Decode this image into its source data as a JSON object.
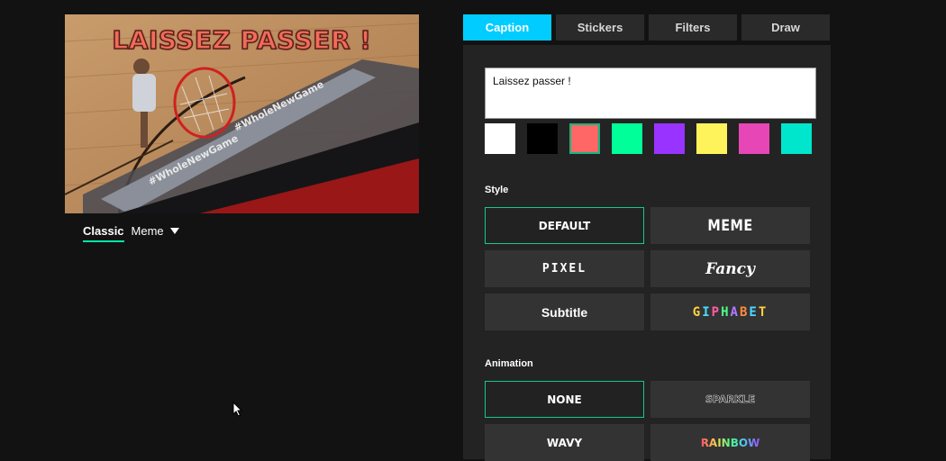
{
  "preview": {
    "caption_text": "LAISSEZ PASSER !",
    "image_description": "basketball-hoop-gif",
    "backboard_texts": [
      "#WholeNewGame",
      "#WholeNewGame"
    ]
  },
  "mode": {
    "classic_label": "Classic",
    "meme_label": "Meme"
  },
  "tabs": [
    {
      "label": "Caption",
      "active": true
    },
    {
      "label": "Stickers",
      "active": false
    },
    {
      "label": "Filters",
      "active": false
    },
    {
      "label": "Draw",
      "active": false
    }
  ],
  "caption_input": {
    "value": "Laissez passer !"
  },
  "swatches": [
    {
      "color": "#ffffff",
      "selected": false
    },
    {
      "color": "#000000",
      "selected": false
    },
    {
      "color": "#ff6666",
      "selected": true
    },
    {
      "color": "#00ff99",
      "selected": false
    },
    {
      "color": "#9933ff",
      "selected": false
    },
    {
      "color": "#fff35c",
      "selected": false
    },
    {
      "color": "#e646b6",
      "selected": false
    },
    {
      "color": "#00e6cc",
      "selected": false
    }
  ],
  "style": {
    "label": "Style",
    "options": [
      {
        "label": "DEFAULT",
        "selected": true
      },
      {
        "label": "MEME",
        "selected": false
      },
      {
        "label": "PIXEL",
        "selected": false
      },
      {
        "label": "Fancy",
        "selected": false
      },
      {
        "label": "Subtitle",
        "selected": false
      },
      {
        "label": "GIPHABET",
        "selected": false
      }
    ]
  },
  "animation": {
    "label": "Animation",
    "options": [
      {
        "label": "NONE",
        "selected": true
      },
      {
        "label": "SPARKLE",
        "selected": false
      },
      {
        "label": "WAVY",
        "selected": false
      },
      {
        "label": "RAINBOW",
        "selected": false
      }
    ]
  },
  "colors": {
    "accent": "#00ccff",
    "selected_border": "#14c98a",
    "panel_bg": "#232323",
    "page_bg": "#121212"
  }
}
